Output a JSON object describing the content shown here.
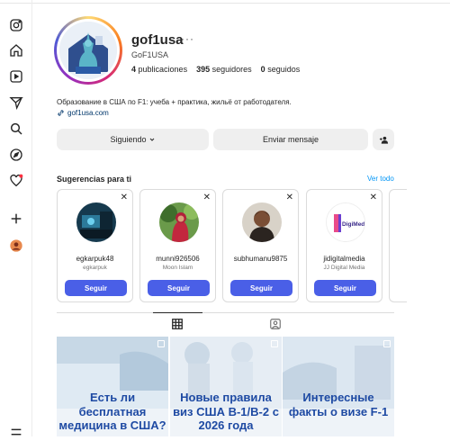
{
  "profile": {
    "username": "gof1usa",
    "more": "···",
    "full_name": "GoF1USA",
    "posts_count": "4",
    "posts_label": "publicaciones",
    "followers_count": "395",
    "followers_label": "seguidores",
    "following_count": "0",
    "following_label": "seguidos",
    "bio": "Образование в США по F1: учеба + практика, жильё от работодателя.",
    "link": "gof1usa.com"
  },
  "actions": {
    "following": "Siguiendo",
    "message": "Enviar mensaje"
  },
  "suggestions": {
    "title": "Sugerencias para ti",
    "see_all": "Ver todo",
    "follow_label": "Seguir",
    "cards": [
      {
        "name": "egkarpuk48",
        "sub": "egkarpuk"
      },
      {
        "name": "munni926506",
        "sub": "Moon Islam"
      },
      {
        "name": "subhumanu9875",
        "sub": ""
      },
      {
        "name": "jidigitalmedia",
        "sub": "JJ Digital Media"
      }
    ]
  },
  "posts": [
    {
      "text": "Есть ли бесплатная медицина в США?"
    },
    {
      "text": "Новые правила виз США В-1/В-2 с 2026 года"
    },
    {
      "text": "Интересные факты о визе F-1"
    }
  ],
  "icons": {
    "rail": [
      "instagram-icon",
      "home-icon",
      "reels-icon",
      "send-icon",
      "search-icon",
      "explore-icon",
      "heart-icon",
      "create-icon",
      "profile-icon",
      "menu-icon"
    ]
  },
  "colors": {
    "primary_button": "#4a5fe7",
    "link": "#00376b",
    "see_all": "#0095f6",
    "post_text": "#1e4aa3"
  }
}
